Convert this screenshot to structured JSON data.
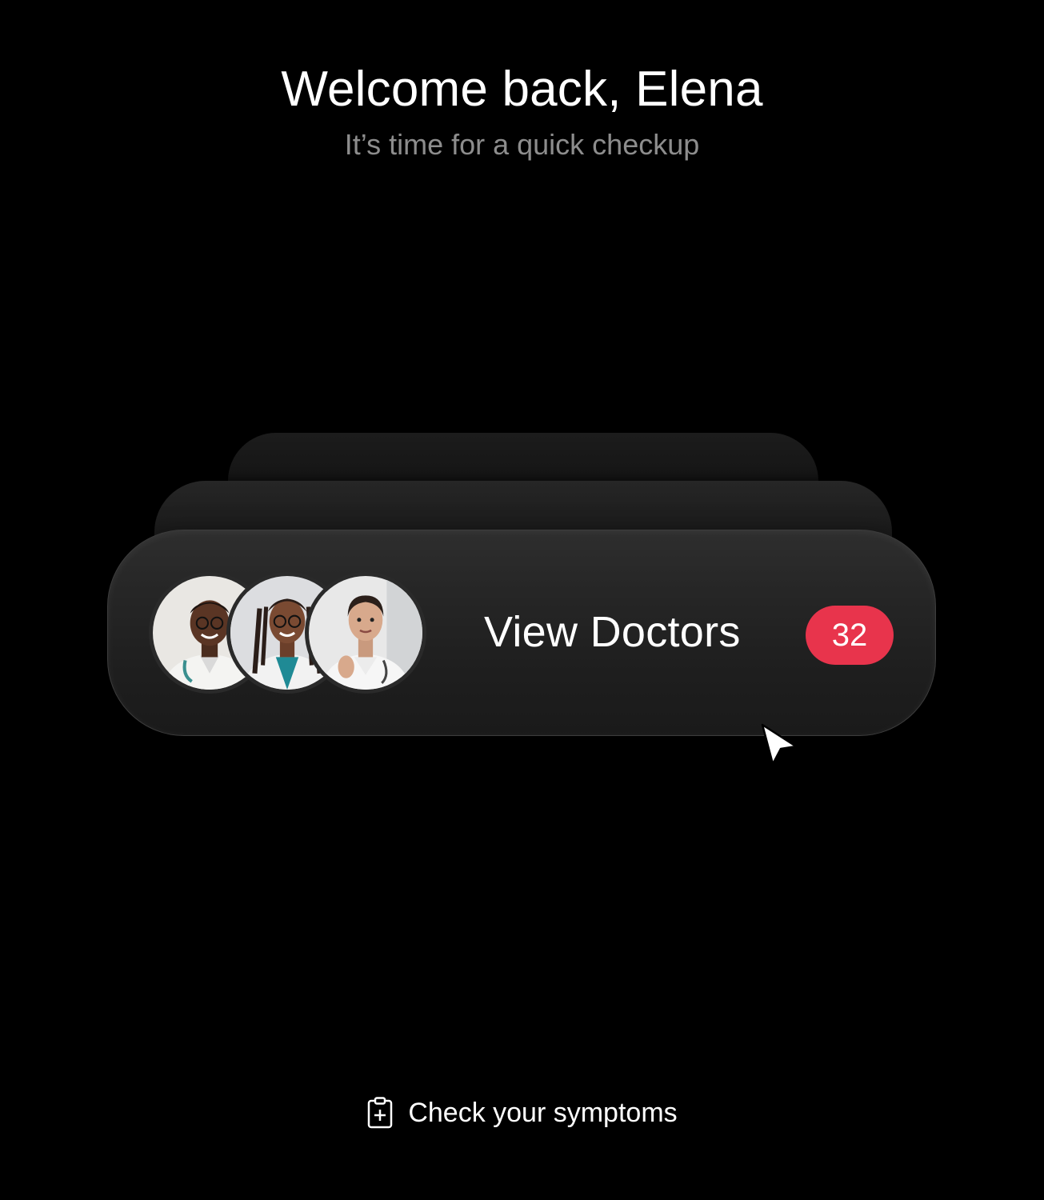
{
  "header": {
    "title": "Welcome back, Elena",
    "subtitle": "It’s time for a quick checkup"
  },
  "doctors_card": {
    "label": "View Doctors",
    "count": "32",
    "badge_color": "#e8344c",
    "avatars": [
      {
        "icon": "doctor-avatar-1"
      },
      {
        "icon": "doctor-avatar-2"
      },
      {
        "icon": "doctor-avatar-3"
      }
    ]
  },
  "footer": {
    "symptoms_label": "Check your symptoms",
    "icon": "clipboard-plus-icon"
  },
  "cursor": {
    "icon": "pointer-cursor-icon"
  }
}
